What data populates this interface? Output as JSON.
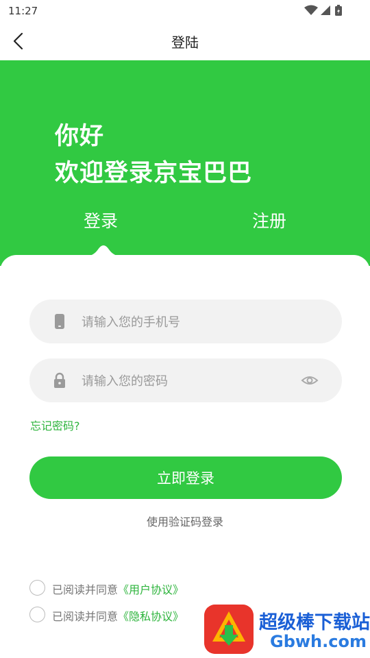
{
  "status_bar": {
    "time": "11:27"
  },
  "nav": {
    "title": "登陆"
  },
  "hero": {
    "greeting_line1": "你好",
    "greeting_line2": "欢迎登录京宝巴巴",
    "tabs": [
      {
        "label": "登录",
        "active": true
      },
      {
        "label": "注册",
        "active": false
      }
    ]
  },
  "form": {
    "phone_placeholder": "请输入您的手机号",
    "password_placeholder": "请输入您的密码",
    "forgot_password": "忘记密码?",
    "login_button": "立即登录",
    "sms_login": "使用验证码登录"
  },
  "agreements": [
    {
      "prefix": "已阅读并同意",
      "link": "《用户协议》"
    },
    {
      "prefix": "已阅读并同意",
      "link": "《隐私协议》"
    }
  ],
  "watermark": {
    "title": "超级棒下载站",
    "subtitle": "Gbwh.com"
  },
  "colors": {
    "brand_green": "#31c942",
    "link_green": "#2db43c"
  }
}
